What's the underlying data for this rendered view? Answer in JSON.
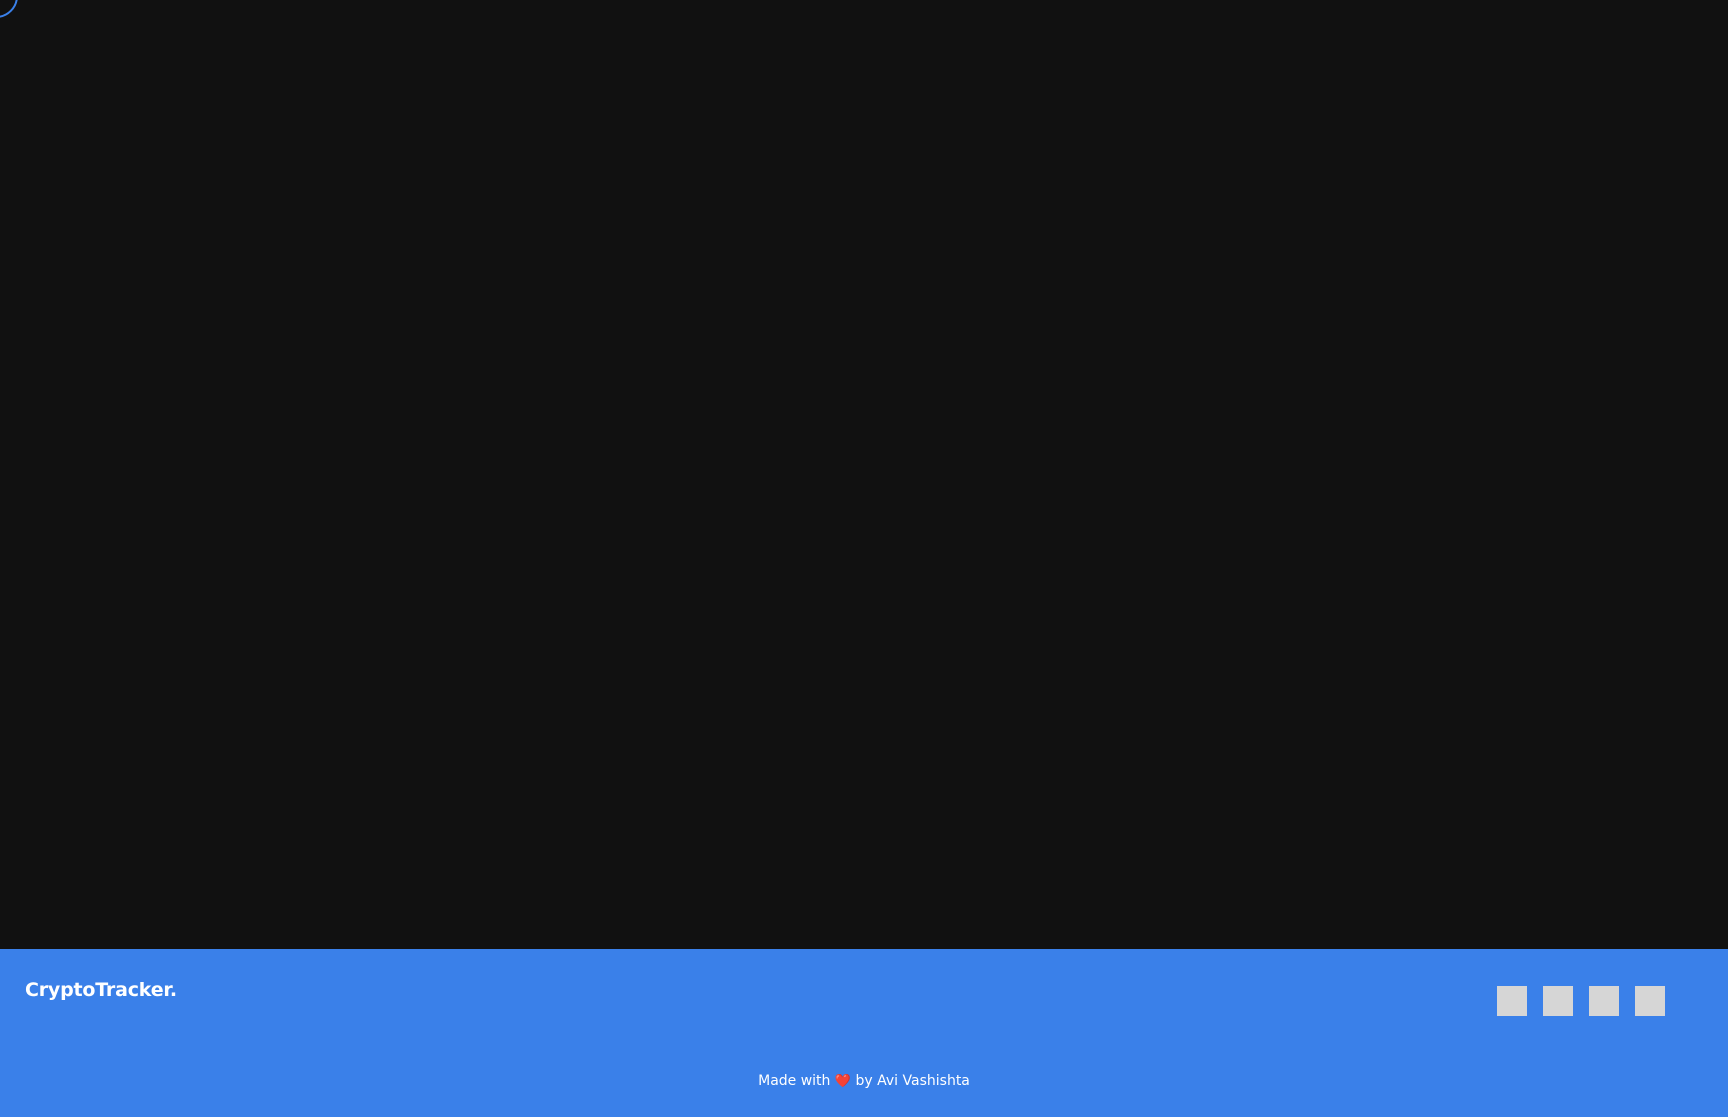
{
  "footer": {
    "logo": "CryptoTracker.",
    "social_icons": [
      "social-icon-1",
      "social-icon-2",
      "social-icon-3",
      "social-icon-4"
    ],
    "credit_prefix": "Made with",
    "credit_heart": "❤️",
    "credit_suffix": "by Avi Vashishta"
  },
  "colors": {
    "background": "#111111",
    "accent": "#3a80e9",
    "icon_placeholder": "#d6d6d6",
    "text": "#ffffff",
    "heart": "#e2231a"
  }
}
